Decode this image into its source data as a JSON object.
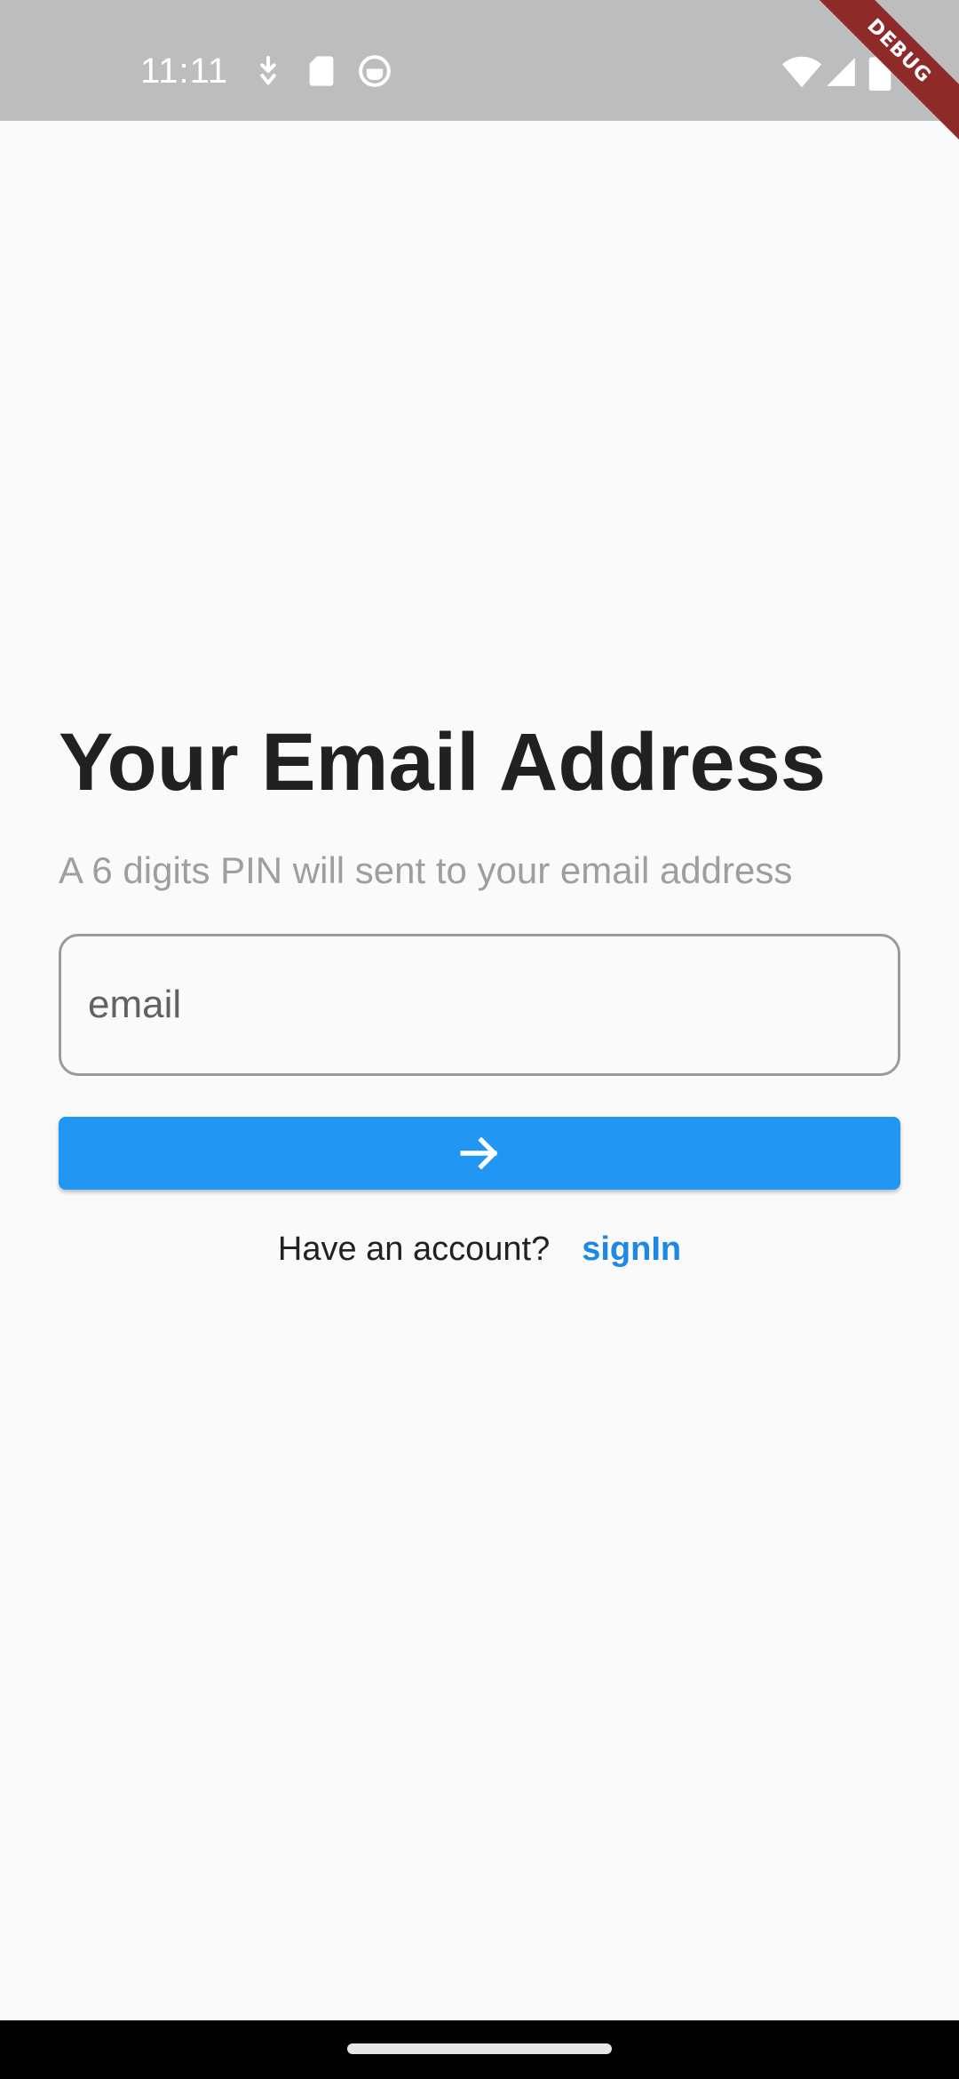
{
  "status_bar": {
    "time": "11:11",
    "left_icons": [
      "download-icon",
      "sd-card-icon",
      "app-notification-icon"
    ],
    "right_icons": [
      "wifi-icon",
      "cell-signal-icon",
      "battery-icon"
    ]
  },
  "debug_banner": {
    "label": "DEBUG",
    "color": "#8e2a2a"
  },
  "main": {
    "title": "Your Email Address",
    "subtitle": "A 6 digits PIN will sent to your email address",
    "email_field": {
      "placeholder": "email",
      "value": ""
    },
    "submit_button": {
      "icon": "arrow-right-icon",
      "color": "#2196f3"
    },
    "account_prompt": {
      "question": "Have an account?",
      "link_label": "signIn",
      "link_color": "#1e88e5"
    }
  },
  "navigation_bar": {
    "handle": "home-handle"
  }
}
